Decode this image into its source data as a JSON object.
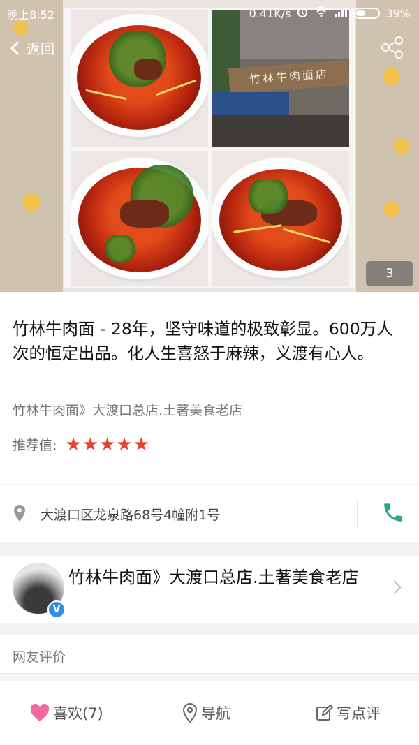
{
  "status_bar": {
    "time": "晚上8:52",
    "network_speed": "0.41K/s",
    "battery": "39%",
    "icons": [
      "alarm-icon",
      "wifi-icon",
      "signal-icon",
      "battery-icon"
    ]
  },
  "header": {
    "back_label": "返回",
    "share_icon": "share-icon"
  },
  "gallery": {
    "photo_count": "3",
    "shop_sign_text": "竹林牛肉面店"
  },
  "listing": {
    "title": "竹林牛肉面 - 28年，坚守味道的极致彰显。600万人次的恒定出品。化人生喜怒于麻辣，义渡有心人。",
    "subtitle": "竹林牛肉面》大渡口总店.土著美食老店",
    "rating_label": "推荐值:",
    "rating_value": 5,
    "rating_max": 5,
    "star_color": "#e7422f"
  },
  "address": {
    "text": "大渡口区龙泉路68号4幢附1号",
    "phone_icon_color": "#27a990"
  },
  "shop": {
    "name": "竹林牛肉面》大渡口总店.土著美食老店",
    "verified_badge": "V"
  },
  "reviews": {
    "title": "网友评价"
  },
  "bottom_bar": {
    "like_label": "喜欢(7)",
    "nav_label": "导航",
    "review_label": "写点评",
    "like_color": "#f06aa0"
  }
}
